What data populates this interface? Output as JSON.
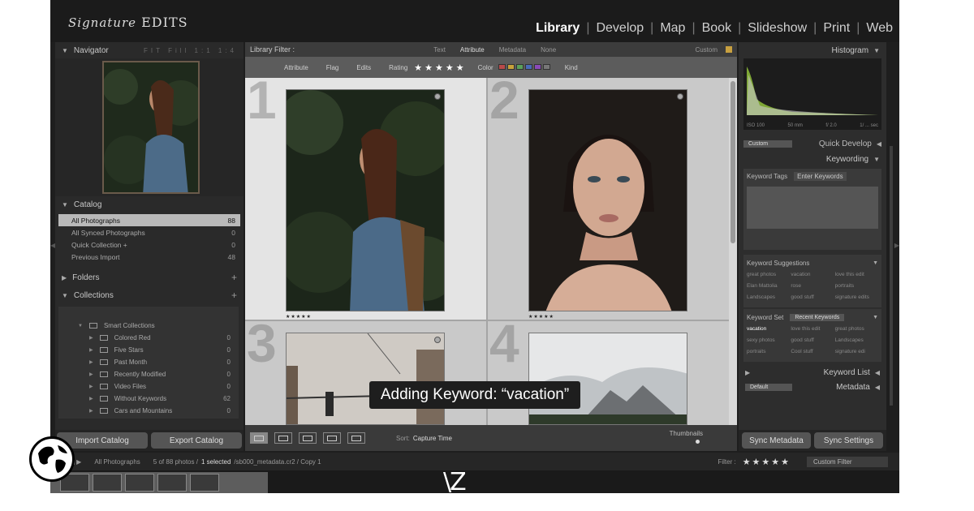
{
  "app": {
    "logo_script": "Signature",
    "logo_text": "EDITS"
  },
  "modules": [
    "Library",
    "Develop",
    "Map",
    "Book",
    "Slideshow",
    "Print",
    "Web"
  ],
  "left_panel": {
    "navigator_title": "Navigator",
    "navigator_opts": "FIT  Fill  1:1  1:4",
    "catalog_title": "Catalog",
    "catalog_items": [
      {
        "label": "All Photographs",
        "count": "88"
      },
      {
        "label": "All Synced Photographs",
        "count": "0"
      },
      {
        "label": "Quick Collection +",
        "count": "0"
      },
      {
        "label": "Previous Import",
        "count": "48"
      }
    ],
    "folders_title": "Folders",
    "collections_title": "Collections",
    "smart_collections_label": "Smart Collections",
    "collections": [
      {
        "label": "Colored Red",
        "count": "0"
      },
      {
        "label": "Five Stars",
        "count": "0"
      },
      {
        "label": "Past Month",
        "count": "0"
      },
      {
        "label": "Recently Modified",
        "count": "0"
      },
      {
        "label": "Video Files",
        "count": "0"
      },
      {
        "label": "Without Keywords",
        "count": "62"
      },
      {
        "label": "Cars and Mountains",
        "count": "0"
      }
    ],
    "import_button": "Import Catalog",
    "export_button": "Export Catalog"
  },
  "filter_bar": {
    "title": "Library Filter :",
    "tabs": [
      "Text",
      "Attribute",
      "Metadata",
      "None"
    ],
    "active_tab": "Attribute",
    "preset": "Custom",
    "attr_label": "Attribute",
    "flag_label": "Flag",
    "edits_label": "Edits",
    "rating_label": "Rating",
    "rating_stars": "★★★★★",
    "color_label": "Color",
    "kind_label": "Kind",
    "colors": [
      "#b84a4a",
      "#c8a23a",
      "#5aa05a",
      "#4a6ab8",
      "#8a4ab8",
      "#777777"
    ]
  },
  "grid": {
    "cells": [
      {
        "num": "1",
        "stars": "★★★★★"
      },
      {
        "num": "2",
        "stars": "★★★★★"
      },
      {
        "num": "3",
        "stars": ""
      },
      {
        "num": "4",
        "stars": ""
      }
    ]
  },
  "toast": "Adding Keyword: “vacation”",
  "toolbar": {
    "sort_label": "Sort:",
    "sort_value": "Capture Time",
    "thumbnails_label": "Thumbnails"
  },
  "right_panel": {
    "histogram_title": "Histogram",
    "histo_info": [
      "ISO 100",
      "50 mm",
      "f/ 2.0",
      "1/ ... sec"
    ],
    "quick_develop": "Quick Develop",
    "quick_develop_preset": "Custom",
    "keywording_title": "Keywording",
    "keyword_tags_label": "Keyword Tags",
    "keyword_tags_value": "Enter Keywords",
    "suggestions_title": "Keyword Suggestions",
    "suggestions": [
      "great photos",
      "vacation",
      "love this edit",
      "Elan Mattolia",
      "rose",
      "portraits",
      "Landscapes",
      "good stuff",
      "signature edits"
    ],
    "keyword_set_label": "Keyword Set",
    "keyword_set_value": "Recent Keywords",
    "keyword_set": [
      "vacation",
      "love this edit",
      "great photos",
      "sexy photos",
      "good stuff",
      "Landscapes",
      "portraits",
      "Cool stuff",
      "signature edi"
    ],
    "keyword_list": "Keyword List",
    "metadata": "Metadata",
    "metadata_preset": "Default",
    "sync_metadata": "Sync Metadata",
    "sync_settings": "Sync Settings"
  },
  "filmstrip": {
    "source": "All Photographs",
    "summary": "5 of 88 photos /",
    "selected": "1 selected",
    "filename": "/sb000_metadata.cr2 / Copy 1",
    "filter_label": "Filter :",
    "stars": "★★★★★",
    "custom_filter": "Custom Filter"
  },
  "lr_logo": "\\Z"
}
